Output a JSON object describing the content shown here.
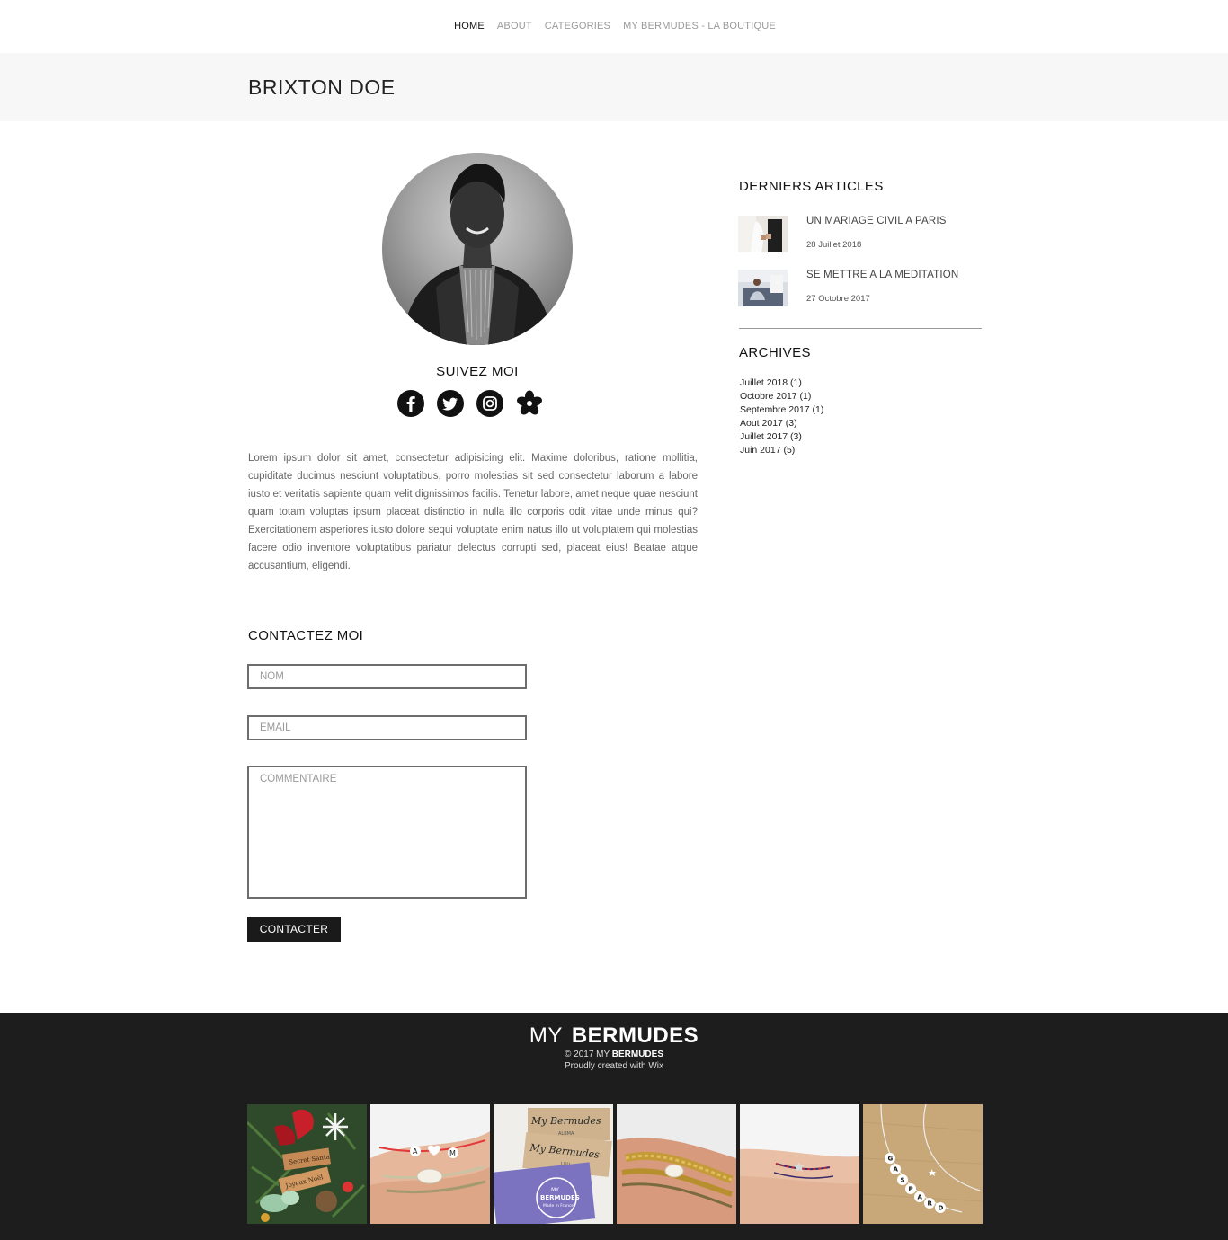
{
  "nav": {
    "items": [
      {
        "label": "HOME"
      },
      {
        "label": "ABOUT"
      },
      {
        "label": "CATEGORIES"
      },
      {
        "label": "MY BERMUDES - LA BOUTIQUE"
      }
    ]
  },
  "page": {
    "title": "BRIXTON DOE"
  },
  "profile": {
    "follow_title": "SUIVEZ MOI",
    "socials": [
      "facebook-icon",
      "twitter-icon",
      "instagram-icon",
      "flower-icon"
    ],
    "bio": "Lorem ipsum dolor sit amet, consectetur adipisicing elit. Maxime doloribus, ratione mollitia, cupiditate ducimus nesciunt voluptatibus, porro molestias sit sed consectetur laborum a labore iusto et veritatis sapiente quam velit dignissimos facilis. Tenetur labore, amet neque quae nesciunt quam totam voluptas ipsum placeat distinctio in nulla illo corporis odit vitae unde minus qui? Exercitationem asperiores iusto dolore sequi voluptate enim natus illo ut voluptatem qui molestias facere odio inventore voluptatibus pariatur delectus corrupti sed, placeat eius! Beatae atque accusantium, eligendi."
  },
  "contact": {
    "title": "CONTACTEZ MOI",
    "name_placeholder": "NOM",
    "email_placeholder": "EMAIL",
    "comment_placeholder": "COMMENTAIRE",
    "button": "CONTACTER"
  },
  "sidebar": {
    "articles_title": "DERNIERS ARTICLES",
    "articles": [
      {
        "title": "UN MARIAGE CIVIL A PARIS",
        "date": "28 Juillet 2018"
      },
      {
        "title": "SE METTRE A LA MEDITATION",
        "date": "27 Octobre 2017"
      }
    ],
    "archives_title": "ARCHIVES",
    "archives": [
      "Juillet 2018 (1)",
      "Octobre 2017 (1)",
      "Septembre 2017 (1)",
      "Aout 2017 (3)",
      "Juillet 2017 (3)",
      "Juin 2017 (5)"
    ]
  },
  "footer": {
    "brand_thin": "MY",
    "brand_bold": "BERMUDES",
    "copy_prefix": "© 2017 MY",
    "copy_bold": "BERMUDES",
    "credit": "Proudly created with Wix",
    "gallery_text": {
      "card1_a": "Secret Santa",
      "card1_b": "Joyeux Noël",
      "bead1": "A",
      "bead2": "M",
      "card3_a": "My Bermudes",
      "card3_b": "ALBMA",
      "card3_c": "My Bermudes",
      "card3_d": "LOU",
      "logo_a": "MY",
      "logo_b": "BERMUDES",
      "logo_c": "Made in France",
      "name_beads": [
        "G",
        "A",
        "S",
        "P",
        "A",
        "R",
        "D"
      ]
    }
  },
  "colors": {
    "footer_bg": "#1d1d1d",
    "title_band_bg": "#f7f7f7",
    "button_bg": "#1a1a1a",
    "nav_active": "#111111",
    "nav_inactive": "#9a9a9a"
  }
}
